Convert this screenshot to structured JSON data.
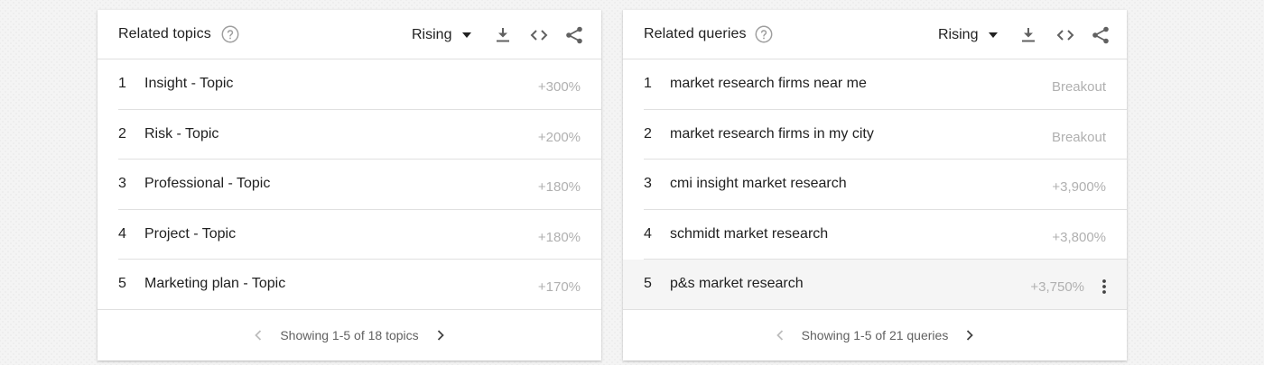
{
  "colors": {
    "icon": "#616161",
    "icon_disabled": "#bdbdbd",
    "value": "#b0b0b0",
    "divider": "#e0e0e0",
    "hover_row": "#f5f5f5"
  },
  "cards": [
    {
      "title": "Related topics",
      "help_icon": "help-circle-icon",
      "sort_label": "Rising",
      "actions": [
        "download-icon",
        "embed-code-icon",
        "share-icon"
      ],
      "rows": [
        {
          "rank": "1",
          "term": "Insight - Topic",
          "value": "+300%"
        },
        {
          "rank": "2",
          "term": "Risk - Topic",
          "value": "+200%"
        },
        {
          "rank": "3",
          "term": "Professional - Topic",
          "value": "+180%"
        },
        {
          "rank": "4",
          "term": "Project - Topic",
          "value": "+180%"
        },
        {
          "rank": "5",
          "term": "Marketing plan - Topic",
          "value": "+170%"
        }
      ],
      "pager_text": "Showing 1-5 of 18 topics"
    },
    {
      "title": "Related queries",
      "help_icon": "help-circle-icon",
      "sort_label": "Rising",
      "actions": [
        "download-icon",
        "embed-code-icon",
        "share-icon"
      ],
      "rows": [
        {
          "rank": "1",
          "term": "market research firms near me",
          "value": "Breakout"
        },
        {
          "rank": "2",
          "term": "market research firms in my city",
          "value": "Breakout"
        },
        {
          "rank": "3",
          "term": "cmi insight market research",
          "value": "+3,900%"
        },
        {
          "rank": "4",
          "term": "schmidt market research",
          "value": "+3,800%"
        },
        {
          "rank": "5",
          "term": "p&s market research",
          "value": "+3,750%"
        }
      ],
      "pager_text": "Showing 1-5 of 21 queries"
    }
  ]
}
